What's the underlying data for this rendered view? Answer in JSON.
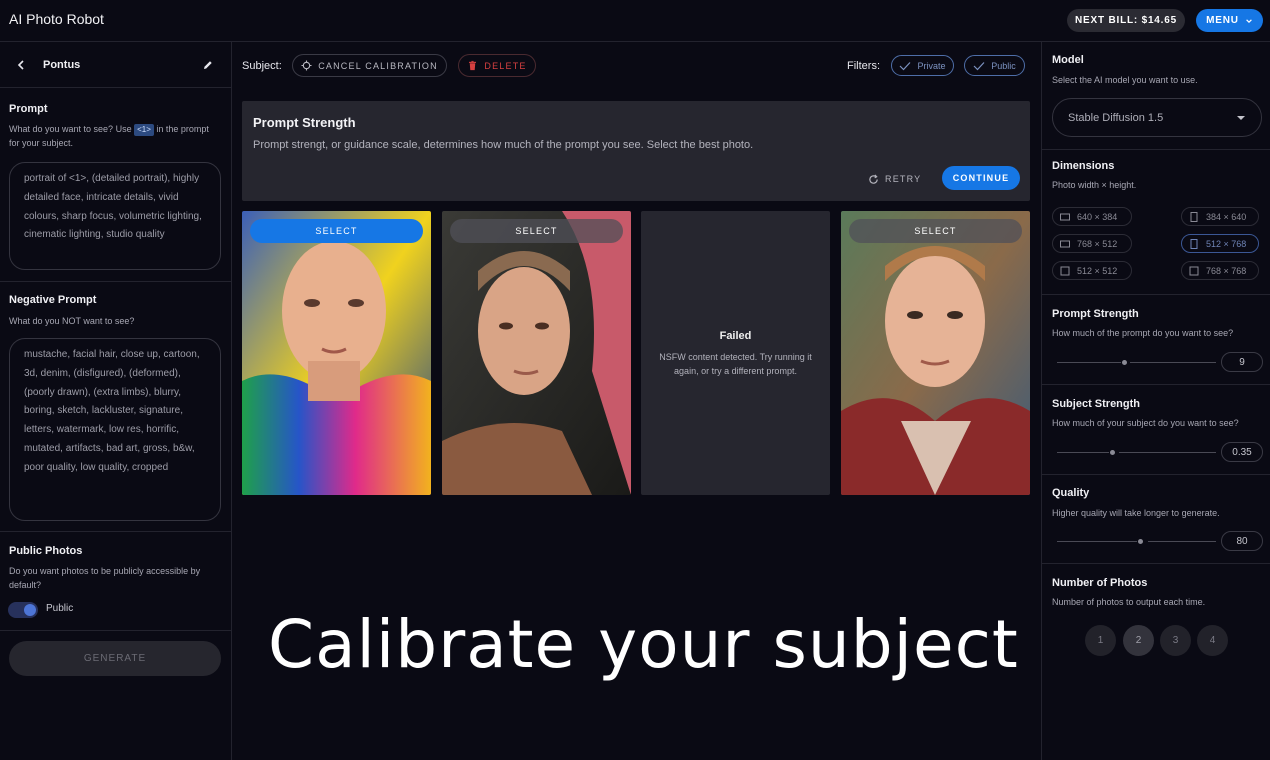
{
  "app": {
    "title": "AI Photo Robot"
  },
  "header": {
    "bill_label": "NEXT BILL: $14.65",
    "menu_label": "MENU"
  },
  "left": {
    "subject_name": "Pontus",
    "prompt": {
      "title": "Prompt",
      "desc_before": "What do you want to see? Use",
      "tag": "<1>",
      "desc_after": "in the prompt for your subject.",
      "value": "portrait of <1>, (detailed portrait), highly detailed face, intricate details, vivid colours, sharp focus, volumetric lighting, cinematic lighting, studio quality"
    },
    "negative": {
      "title": "Negative Prompt",
      "desc": "What do you NOT want to see?",
      "value": "mustache, facial hair, close up, cartoon, 3d, denim, (disfigured), (deformed), (poorly drawn), (extra limbs), blurry, boring, sketch, lackluster, signature, letters, watermark, low res, horrific, mutated, artifacts, bad art, gross, b&w, poor quality, low quality, cropped"
    },
    "public": {
      "title": "Public Photos",
      "desc": "Do you want photos to be publicly accessible by default?",
      "toggle_label": "Public",
      "on": true
    },
    "generate_label": "GENERATE"
  },
  "toolbar": {
    "subject_label": "Subject:",
    "cancel_label": "CANCEL CALIBRATION",
    "delete_label": "DELETE",
    "filters_label": "Filters:",
    "filter_private": "Private",
    "filter_public": "Public"
  },
  "prompt_strength_panel": {
    "title": "Prompt Strength",
    "desc": "Prompt strengt, or guidance scale, determines how much of the prompt you see. Select the best photo.",
    "retry_label": "RETRY",
    "continue_label": "CONTINUE"
  },
  "photos": [
    {
      "select_label": "SELECT",
      "state": "selected"
    },
    {
      "select_label": "SELECT",
      "state": "normal"
    },
    {
      "state": "failed",
      "failed_title": "Failed",
      "failed_desc": "NSFW content detected. Try running it again, or try a different prompt."
    },
    {
      "select_label": "SELECT",
      "state": "normal"
    }
  ],
  "caption": "Calibrate your subject",
  "right": {
    "model": {
      "title": "Model",
      "desc": "Select the AI model you want to use.",
      "value": "Stable Diffusion 1.5"
    },
    "dimensions": {
      "title": "Dimensions",
      "desc": "Photo width × height.",
      "options": [
        "640 × 384",
        "384 × 640",
        "768 × 512",
        "512 × 768",
        "512 × 512",
        "768 × 768"
      ],
      "selected": "512 × 768"
    },
    "prompt_strength": {
      "title": "Prompt Strength",
      "desc": "How much of the prompt do you want to see?",
      "value": "9"
    },
    "subject_strength": {
      "title": "Subject Strength",
      "desc": "How much of your subject do you want to see?",
      "value": "0.35"
    },
    "quality": {
      "title": "Quality",
      "desc": "Higher quality will take longer to generate.",
      "value": "80"
    },
    "number_of_photos": {
      "title": "Number of Photos",
      "desc": "Number of photos to output each time.",
      "options": [
        "1",
        "2",
        "3",
        "4"
      ],
      "selected": "2"
    }
  },
  "colors": {
    "accent": "#1677e5",
    "background": "#0a0a14",
    "panel": "#26262f",
    "danger": "#d64040"
  }
}
